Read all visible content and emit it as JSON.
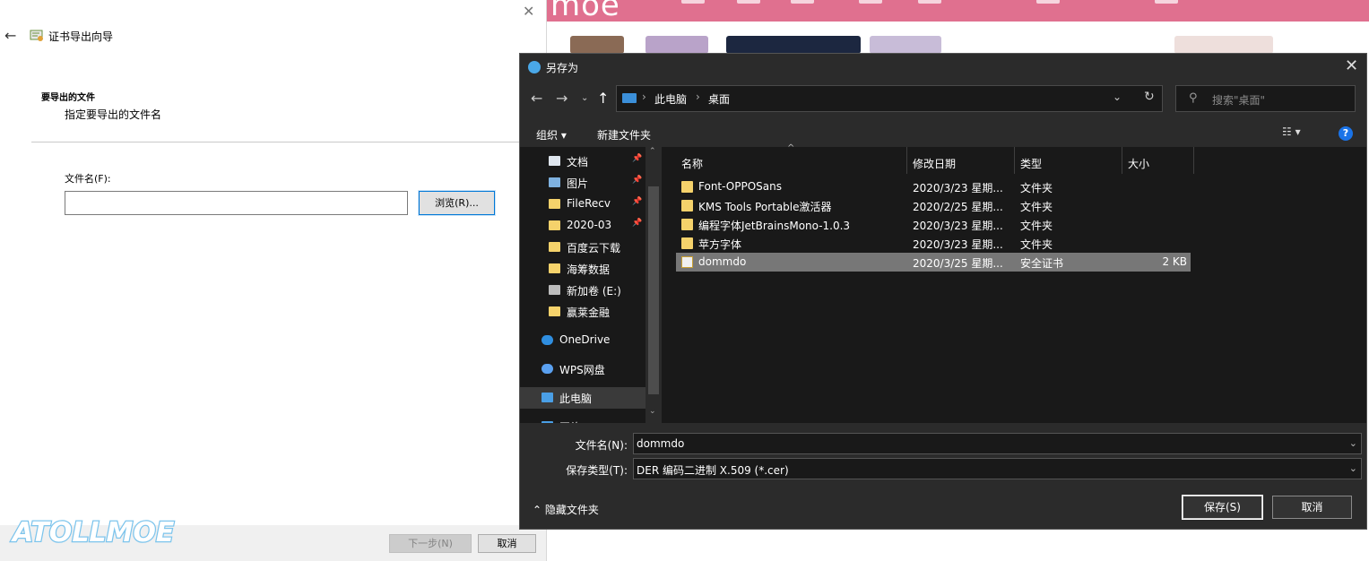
{
  "wizard": {
    "title": "证书导出向导",
    "section_title": "要导出的文件",
    "section_desc": "指定要导出的文件名",
    "file_label": "文件名(F):",
    "file_value": "",
    "browse_label": "浏览(R)...",
    "next_label": "下一步(N)",
    "cancel_label": "取消"
  },
  "watermark_text": "ATOLLMOE",
  "website": {
    "logo_text": "moe"
  },
  "dialog": {
    "title": "另存为",
    "breadcrumb": [
      "此电脑",
      "桌面"
    ],
    "search_placeholder": "搜索\"桌面\"",
    "toolbar": {
      "organize": "组织 ▾",
      "new_folder": "新建文件夹"
    },
    "nav_items": [
      {
        "label": "文档",
        "icon": "document-icon",
        "pinned": true
      },
      {
        "label": "图片",
        "icon": "picture-icon",
        "pinned": true
      },
      {
        "label": "FileRecv",
        "icon": "folder-icon",
        "pinned": true
      },
      {
        "label": "2020-03",
        "icon": "folder-icon",
        "pinned": true
      },
      {
        "label": "百度云下载",
        "icon": "folder-icon",
        "pinned": false
      },
      {
        "label": "海筹数据",
        "icon": "folder-icon",
        "pinned": false
      },
      {
        "label": "新加卷 (E:)",
        "icon": "drive-icon",
        "pinned": false
      },
      {
        "label": "赢莱金融",
        "icon": "folder-icon",
        "pinned": false
      },
      {
        "label": "OneDrive",
        "icon": "cloud-icon",
        "pinned": false
      },
      {
        "label": "WPS网盘",
        "icon": "wps-cloud-icon",
        "pinned": false
      },
      {
        "label": "此电脑",
        "icon": "computer-icon",
        "pinned": false
      },
      {
        "label": "网络",
        "icon": "network-icon",
        "pinned": false
      }
    ],
    "columns": [
      "名称",
      "修改日期",
      "类型",
      "大小"
    ],
    "files": [
      {
        "name": "Font-OPPOSans",
        "date": "2020/3/23 星期...",
        "type": "文件夹",
        "size": "",
        "icon": "folder-icon"
      },
      {
        "name": "KMS Tools Portable激活器",
        "date": "2020/2/25 星期...",
        "type": "文件夹",
        "size": "",
        "icon": "folder-icon"
      },
      {
        "name": "编程字体JetBrainsMono-1.0.3",
        "date": "2020/3/23 星期...",
        "type": "文件夹",
        "size": "",
        "icon": "folder-icon"
      },
      {
        "name": "苹方字体",
        "date": "2020/3/23 星期...",
        "type": "文件夹",
        "size": "",
        "icon": "folder-icon"
      },
      {
        "name": "dommdo",
        "date": "2020/3/25 星期...",
        "type": "安全证书",
        "size": "2 KB",
        "icon": "certificate-icon",
        "selected": true
      }
    ],
    "filename_label": "文件名(N):",
    "filename_value": "dommdo",
    "filetype_label": "保存类型(T):",
    "filetype_value": "DER 编码二进制 X.509 (*.cer)",
    "hide_folders": "隐藏文件夹",
    "save_label": "保存(S)",
    "cancel_label": "取消"
  }
}
